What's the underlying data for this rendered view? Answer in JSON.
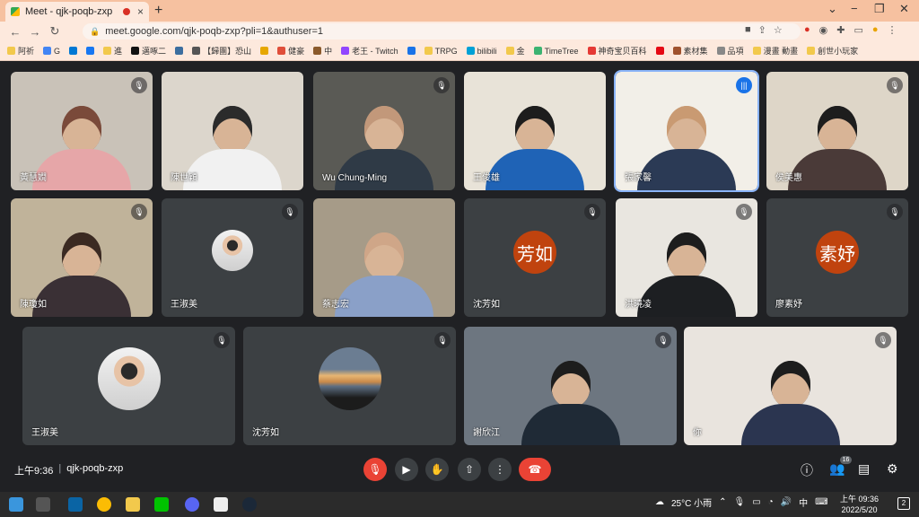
{
  "browser": {
    "tab_title": "Meet - qjk-poqb-zxp",
    "tab_close": "×",
    "new_tab": "+",
    "url": "meet.google.com/qjk-poqb-zxp?pli=1&authuser=1",
    "win_min": "−",
    "win_max": "❐",
    "win_close": "✕",
    "bookmarks": [
      {
        "label": "阿祈",
        "color": "#f2c94c"
      },
      {
        "label": "G",
        "color": "#4285f4"
      },
      {
        "label": "",
        "color": "#0078d4"
      },
      {
        "label": "",
        "color": "#1877f2"
      },
      {
        "label": "進",
        "color": "#f2c94c"
      },
      {
        "label": "邁啄二",
        "color": "#111111"
      },
      {
        "label": "",
        "color": "#3c6e9f"
      },
      {
        "label": "【歸團】恐山",
        "color": "#555555"
      },
      {
        "label": "",
        "color": "#e6a700"
      },
      {
        "label": "健豪",
        "color": "#e04e39"
      },
      {
        "label": "中",
        "color": "#8b5a2b"
      },
      {
        "label": "老王 - Twitch",
        "color": "#9146ff"
      },
      {
        "label": "",
        "color": "#1a73e8"
      },
      {
        "label": "TRPG",
        "color": "#f2c94c"
      },
      {
        "label": "bilibili",
        "color": "#00a1d6"
      },
      {
        "label": "金",
        "color": "#f2c94c"
      },
      {
        "label": "TimeTree",
        "color": "#3cb371"
      },
      {
        "label": "神奇宝贝百科",
        "color": "#e53935"
      },
      {
        "label": "",
        "color": "#e50914"
      },
      {
        "label": "素材集",
        "color": "#a0522d"
      },
      {
        "label": "品項",
        "color": "#888888"
      },
      {
        "label": "漫畫 動畫",
        "color": "#f2c94c"
      },
      {
        "label": "創世小玩家",
        "color": "#f2c94c"
      }
    ]
  },
  "meet": {
    "participants": [
      {
        "name": "黃慧嫺",
        "kind": "video",
        "muted": true
      },
      {
        "name": "陳世穎",
        "kind": "video",
        "muted": false
      },
      {
        "name": "Wu Chung-Ming",
        "kind": "video",
        "muted": true
      },
      {
        "name": "王俊雄",
        "kind": "video",
        "muted": false
      },
      {
        "name": "張家馨",
        "kind": "video",
        "muted": false,
        "speaking": true
      },
      {
        "name": "侯美惠",
        "kind": "video",
        "muted": true
      },
      {
        "name": "陳瓊如",
        "kind": "video",
        "muted": true
      },
      {
        "name": "王淑美",
        "kind": "photo",
        "muted": true
      },
      {
        "name": "蔡志宏",
        "kind": "video",
        "muted": false
      },
      {
        "name": "沈芳如",
        "kind": "letter",
        "letter": "芳如",
        "color": "#c0430e",
        "muted": true
      },
      {
        "name": "洪曉凌",
        "kind": "video",
        "muted": true
      },
      {
        "name": "廖素妤",
        "kind": "letter",
        "letter": "素妤",
        "color": "#c0430e",
        "muted": true
      },
      {
        "name": "王淑美",
        "kind": "photo",
        "muted": true
      },
      {
        "name": "沈芳如",
        "kind": "photo",
        "muted": true
      },
      {
        "name": "謝欣江",
        "kind": "video",
        "muted": true
      },
      {
        "name": "你",
        "kind": "video",
        "muted": true
      }
    ],
    "time": "上午9:36",
    "separator": "|",
    "meeting_code": "qjk-poqb-zxp",
    "participant_count": "16",
    "accent_red": "#ea4335"
  },
  "taskbar": {
    "weather": "25°C 小雨",
    "clock_time": "上午 09:36",
    "clock_date": "2022/5/20",
    "ime": "中",
    "notification_count": "2"
  }
}
